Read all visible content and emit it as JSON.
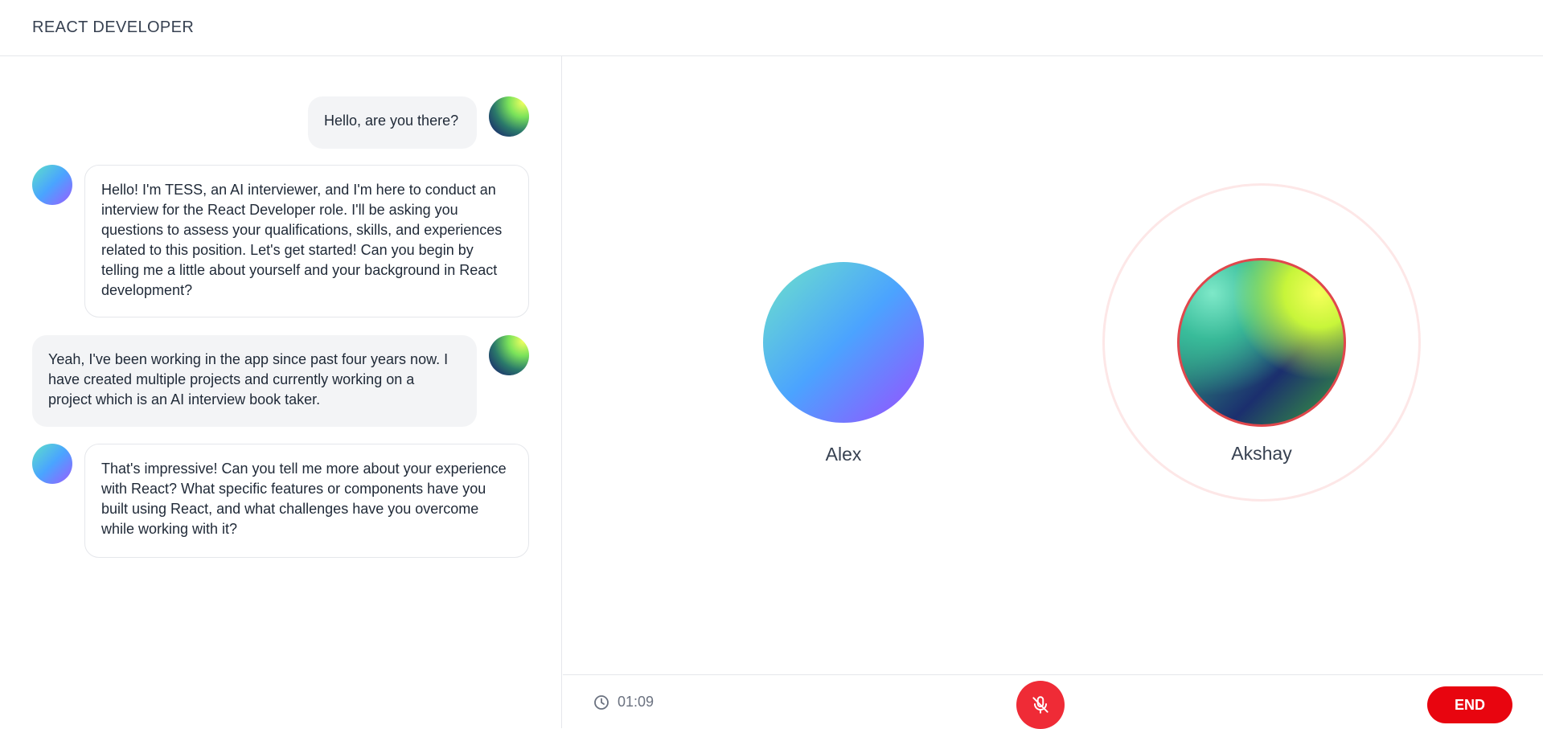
{
  "header": {
    "title": "REACT DEVELOPER"
  },
  "chat": {
    "messages": [
      {
        "role": "user",
        "text": "Hello, are you there?"
      },
      {
        "role": "ai",
        "text": "Hello! I'm TESS, an AI interviewer, and I'm here to conduct an interview for the React Developer role. I'll be asking you questions to assess your qualifications, skills, and experiences related to this position. Let's get started! Can you begin by telling me a little about yourself and your background in React development?"
      },
      {
        "role": "user",
        "text": "Yeah, I've been working in the app since past four years now. I have created multiple projects and currently working on a project which is an AI interview book taker."
      },
      {
        "role": "ai",
        "text": "That's impressive! Can you tell me more about your experience with React? What specific features or components have you built using React, and what challenges have you overcome while working with it?"
      }
    ]
  },
  "stage": {
    "participants": [
      {
        "name": "Alex",
        "speaking": false
      },
      {
        "name": "Akshay",
        "speaking": true
      }
    ]
  },
  "controls": {
    "timer": "01:09",
    "timer_icon": "clock-icon",
    "mic_icon": "mic-off-icon",
    "mic_muted": true,
    "end_label": "END",
    "colors": {
      "mic": "#ef2b36",
      "end": "#e8050f",
      "speaking_ring": "#e0474c"
    }
  }
}
